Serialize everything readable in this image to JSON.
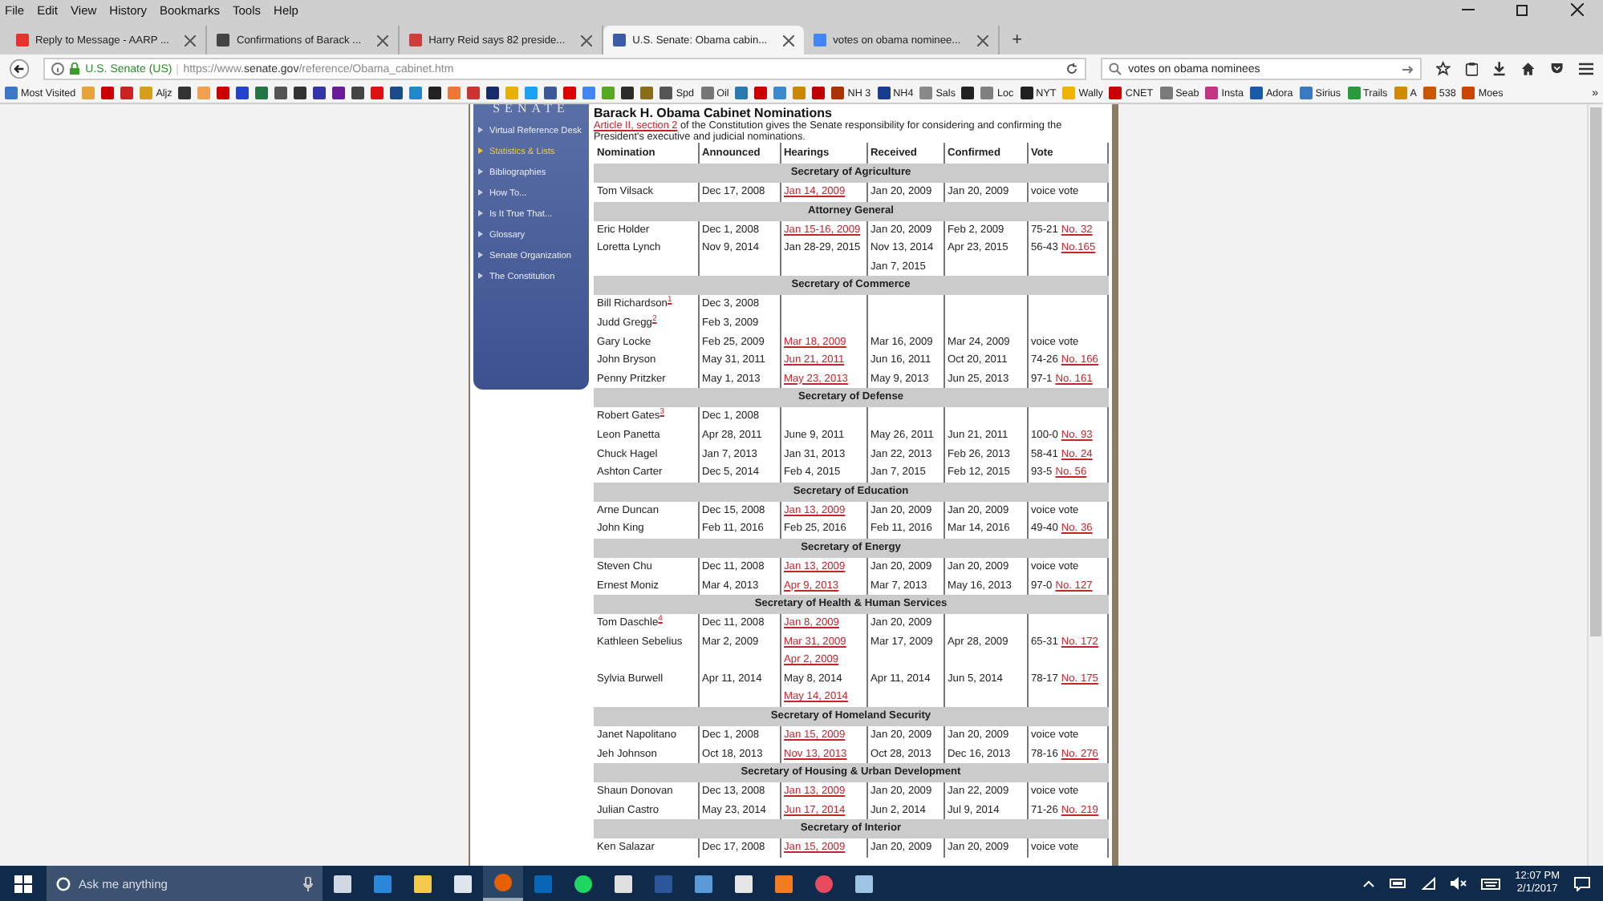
{
  "menu_bar": [
    "File",
    "Edit",
    "View",
    "History",
    "Bookmarks",
    "Tools",
    "Help"
  ],
  "tabs": [
    {
      "title": "Reply to Message - AARP ...",
      "selected": false,
      "color": "#e8322d"
    },
    {
      "title": "Confirmations of Barack ...",
      "selected": false,
      "color": "#444444"
    },
    {
      "title": "Harry Reid says 82 preside...",
      "selected": false,
      "color": "#d03c3c"
    },
    {
      "title": "U.S. Senate: Obama cabin...",
      "selected": true,
      "color": "#3b5ba8"
    },
    {
      "title": "votes on obama nominee...",
      "selected": false,
      "color": "#4285f4"
    }
  ],
  "new_tab": "+",
  "address": {
    "site": "U.S. Senate (US)",
    "url_prefix": "https://www.",
    "domain": "senate.gov",
    "url_path": "/reference/Obama_cabinet.htm"
  },
  "search_field": {
    "value": "votes on obama nominees"
  },
  "bookmarks": [
    {
      "label": "Most Visited",
      "color": "#3c78c8"
    },
    {
      "color": "#e8a33c"
    },
    {
      "color": "#cc0000"
    },
    {
      "color": "#cc2222"
    },
    {
      "label": "Aljz",
      "color": "#d4a017"
    },
    {
      "color": "#333333"
    },
    {
      "color": "#f0a050"
    },
    {
      "color": "#cc0000"
    },
    {
      "color": "#2244cc"
    },
    {
      "color": "#227744"
    },
    {
      "color": "#555555"
    },
    {
      "color": "#333333"
    },
    {
      "color": "#3333aa"
    },
    {
      "color": "#6a1b9a"
    },
    {
      "color": "#444444"
    },
    {
      "color": "#dd1111"
    },
    {
      "color": "#1a4c8c"
    },
    {
      "color": "#2288cc"
    },
    {
      "color": "#222222"
    },
    {
      "color": "#ee7733"
    },
    {
      "color": "#cc3333"
    },
    {
      "color": "#1a2a6c"
    },
    {
      "color": "#e8b000"
    },
    {
      "color": "#1da1f2"
    },
    {
      "color": "#3b5998"
    },
    {
      "color": "#dd0000"
    },
    {
      "color": "#4285f4"
    },
    {
      "color": "#55aa22"
    },
    {
      "color": "#2b2b2b"
    },
    {
      "color": "#8a6d1a"
    },
    {
      "label": "Spd",
      "color": "#555555"
    },
    {
      "label": "Oil",
      "color": "#777777"
    },
    {
      "color": "#2a7ab0"
    },
    {
      "color": "#cc0000"
    },
    {
      "color": "#3a8ad0"
    },
    {
      "color": "#cc8800"
    },
    {
      "color": "#c00000"
    },
    {
      "label": "NH 3",
      "color": "#aa3300"
    },
    {
      "label": "NH4",
      "color": "#1a3c8c"
    },
    {
      "label": "Sals",
      "color": "#888888"
    },
    {
      "color": "#222222"
    },
    {
      "label": "Loc",
      "color": "#808080"
    },
    {
      "label": "NYT",
      "color": "#202020"
    },
    {
      "label": "Wally",
      "color": "#f0b400"
    },
    {
      "label": "CNET",
      "color": "#cc0000"
    },
    {
      "label": "Seab",
      "color": "#7a7a7a"
    },
    {
      "label": "Insta",
      "color": "#c13584"
    },
    {
      "label": "Adora",
      "color": "#1a5aa8"
    },
    {
      "label": "Sirius",
      "color": "#3a7ac0"
    },
    {
      "label": "Trails",
      "color": "#2a9a3a"
    },
    {
      "label": "A",
      "color": "#d08a00"
    },
    {
      "label": "538",
      "color": "#cc5500"
    },
    {
      "label": "Moes",
      "color": "#cc4400"
    }
  ],
  "bookmarks_overflow": "»",
  "sidebar": {
    "logo": "SENATE",
    "items": [
      {
        "label": "Virtual Reference Desk",
        "selected": false
      },
      {
        "label": "Statistics & Lists",
        "selected": true
      },
      {
        "label": "Bibliographies",
        "selected": false
      },
      {
        "label": "How To...",
        "selected": false
      },
      {
        "label": "Is It True That...",
        "selected": false
      },
      {
        "label": "Glossary",
        "selected": false
      },
      {
        "label": "Senate Organization",
        "selected": false
      },
      {
        "label": "The Constitution",
        "selected": false
      }
    ]
  },
  "page_title": "Barack H. Obama Cabinet Nominations",
  "intro": {
    "link": "Article II, section 2",
    "text": " of the Constitution gives the Senate responsibility for considering and confirming the President's executive and judicial nominations."
  },
  "table": {
    "columns": [
      "Nomination",
      "Announced",
      "Hearings",
      "Received",
      "Confirmed",
      "Vote"
    ],
    "sections": [
      {
        "title": "Secretary of Agriculture",
        "rows": [
          {
            "name": "Tom Vilsack",
            "announced": "Dec 17, 2008",
            "hearings": [
              {
                "text": "Jan 14, 2009",
                "link": true
              }
            ],
            "received": [
              "Jan 20, 2009"
            ],
            "confirmed": "Jan 20, 2009",
            "vote": {
              "tally": "voice vote"
            }
          }
        ]
      },
      {
        "title": "Attorney General",
        "rows": [
          {
            "name": "Eric Holder",
            "announced": "Dec 1, 2008",
            "hearings": [
              {
                "text": "Jan 15-16, 2009",
                "link": true
              }
            ],
            "received": [
              "Jan 20, 2009"
            ],
            "confirmed": "Feb 2, 2009",
            "vote": {
              "tally": "75-21",
              "roll_call": "No. 32"
            }
          },
          {
            "name": "Loretta Lynch",
            "announced": "Nov 9, 2014",
            "hearings": [
              {
                "text": "Jan 28-29, 2015",
                "link": false
              }
            ],
            "received": [
              "Nov 13, 2014",
              "Jan 7, 2015"
            ],
            "confirmed": "Apr 23, 2015",
            "vote": {
              "tally": "56-43",
              "roll_call": "No.165"
            }
          }
        ]
      },
      {
        "title": "Secretary of Commerce",
        "rows": [
          {
            "name": "Bill Richardson",
            "footnote": "1",
            "announced": "Dec 3, 2008"
          },
          {
            "name": "Judd Gregg",
            "footnote": "2",
            "announced": "Feb 3, 2009"
          },
          {
            "name": "Gary Locke",
            "announced": "Feb 25, 2009",
            "hearings": [
              {
                "text": "Mar 18, 2009",
                "link": true
              }
            ],
            "received": [
              "Mar 16, 2009"
            ],
            "confirmed": "Mar 24, 2009",
            "vote": {
              "tally": "voice vote"
            }
          },
          {
            "name": "John Bryson",
            "announced": "May 31, 2011",
            "hearings": [
              {
                "text": "Jun 21, 2011",
                "link": true
              }
            ],
            "received": [
              "Jun 16, 2011"
            ],
            "confirmed": "Oct 20, 2011",
            "vote": {
              "tally": "74-26",
              "roll_call": "No. 166"
            }
          },
          {
            "name": "Penny Pritzker",
            "announced": "May 1, 2013",
            "hearings": [
              {
                "text": "May 23, 2013",
                "link": true
              }
            ],
            "received": [
              "May 9, 2013"
            ],
            "confirmed": "Jun 25, 2013",
            "vote": {
              "tally": "97-1",
              "roll_call": "No. 161"
            }
          }
        ]
      },
      {
        "title": "Secretary of Defense",
        "rows": [
          {
            "name": "Robert Gates",
            "footnote": "3",
            "announced": "Dec 1, 2008"
          },
          {
            "name": "Leon Panetta",
            "announced": "Apr 28, 2011",
            "hearings": [
              {
                "text": "June 9, 2011",
                "link": false
              }
            ],
            "received": [
              "May 26, 2011"
            ],
            "confirmed": "Jun 21, 2011",
            "vote": {
              "tally": "100-0",
              "roll_call": "No. 93"
            }
          },
          {
            "name": "Chuck Hagel",
            "announced": "Jan 7, 2013",
            "hearings": [
              {
                "text": "Jan 31, 2013",
                "link": false
              }
            ],
            "received": [
              "Jan 22, 2013"
            ],
            "confirmed": "Feb 26, 2013",
            "vote": {
              "tally": "58-41",
              "roll_call": "No. 24"
            }
          },
          {
            "name": "Ashton Carter",
            "announced": "Dec 5, 2014",
            "hearings": [
              {
                "text": "Feb 4, 2015",
                "link": false
              }
            ],
            "received": [
              "Jan 7, 2015"
            ],
            "confirmed": "Feb 12, 2015",
            "vote": {
              "tally": "93-5",
              "roll_call": "No. 56"
            }
          }
        ]
      },
      {
        "title": "Secretary of Education",
        "rows": [
          {
            "name": "Arne Duncan",
            "announced": "Dec 15, 2008",
            "hearings": [
              {
                "text": "Jan 13, 2009",
                "link": true
              }
            ],
            "received": [
              "Jan 20, 2009"
            ],
            "confirmed": "Jan 20, 2009",
            "vote": {
              "tally": "voice vote"
            }
          },
          {
            "name": "John King",
            "announced": "Feb 11, 2016",
            "hearings": [
              {
                "text": "Feb 25, 2016",
                "link": false
              }
            ],
            "received": [
              "Feb 11, 2016"
            ],
            "confirmed": "Mar 14, 2016",
            "vote": {
              "tally": "49-40",
              "roll_call": "No. 36"
            }
          }
        ]
      },
      {
        "title": "Secretary of Energy",
        "rows": [
          {
            "name": "Steven Chu",
            "announced": "Dec 11, 2008",
            "hearings": [
              {
                "text": "Jan 13, 2009",
                "link": true
              }
            ],
            "received": [
              "Jan 20, 2009"
            ],
            "confirmed": "Jan 20, 2009",
            "vote": {
              "tally": "voice vote"
            }
          },
          {
            "name": "Ernest Moniz",
            "announced": "Mar 4, 2013",
            "hearings": [
              {
                "text": "Apr 9, 2013",
                "link": true
              }
            ],
            "received": [
              "Mar 7, 2013"
            ],
            "confirmed": "May 16, 2013",
            "vote": {
              "tally": "97-0",
              "roll_call": "No. 127"
            }
          }
        ]
      },
      {
        "title": "Secretary of Health & Human Services",
        "rows": [
          {
            "name": "Tom Daschle",
            "footnote": "4",
            "announced": "Dec 11, 2008",
            "hearings": [
              {
                "text": "Jan 8, 2009",
                "link": true
              }
            ],
            "received": [
              "Jan 20, 2009"
            ]
          },
          {
            "name": "Kathleen Sebelius",
            "announced": "Mar 2, 2009",
            "hearings": [
              {
                "text": "Mar 31, 2009",
                "link": true
              },
              {
                "text": "Apr 2, 2009",
                "link": true
              }
            ],
            "received": [
              "Mar 17, 2009"
            ],
            "confirmed": "Apr 28, 2009",
            "vote": {
              "tally": "65-31",
              "roll_call": "No. 172"
            }
          },
          {
            "name": "Sylvia Burwell",
            "announced": "Apr 11, 2014",
            "hearings": [
              {
                "text": "May 8, 2014",
                "link": false
              },
              {
                "text": "May 14, 2014",
                "link": true
              }
            ],
            "received": [
              "Apr 11, 2014"
            ],
            "confirmed": "Jun 5, 2014",
            "vote": {
              "tally": "78-17",
              "roll_call": "No. 175"
            }
          }
        ]
      },
      {
        "title": "Secretary of Homeland Security",
        "rows": [
          {
            "name": "Janet Napolitano",
            "announced": "Dec 1, 2008",
            "hearings": [
              {
                "text": "Jan 15, 2009",
                "link": true
              }
            ],
            "received": [
              "Jan 20, 2009"
            ],
            "confirmed": "Jan 20, 2009",
            "vote": {
              "tally": "voice vote"
            }
          },
          {
            "name": "Jeh Johnson",
            "announced": "Oct 18, 2013",
            "hearings": [
              {
                "text": "Nov 13, 2013",
                "link": true
              }
            ],
            "received": [
              "Oct 28, 2013"
            ],
            "confirmed": "Dec 16, 2013",
            "vote": {
              "tally": "78-16",
              "roll_call": "No. 276"
            }
          }
        ]
      },
      {
        "title": "Secretary of Housing & Urban Development",
        "rows": [
          {
            "name": "Shaun Donovan",
            "announced": "Dec 13, 2008",
            "hearings": [
              {
                "text": "Jan 13, 2009",
                "link": true
              }
            ],
            "received": [
              "Jan 20, 2009"
            ],
            "confirmed": "Jan 22, 2009",
            "vote": {
              "tally": "voice vote"
            }
          },
          {
            "name": "Julian Castro",
            "announced": "May 23, 2014",
            "hearings": [
              {
                "text": "Jun 17, 2014",
                "link": true
              }
            ],
            "received": [
              "Jun 2, 2014"
            ],
            "confirmed": "Jul 9, 2014",
            "vote": {
              "tally": "71-26",
              "roll_call": "No. 219"
            }
          }
        ]
      },
      {
        "title": "Secretary of Interior",
        "rows": [
          {
            "name": "Ken Salazar",
            "announced": "Dec 17, 2008",
            "hearings": [
              {
                "text": "Jan 15, 2009",
                "link": true
              }
            ],
            "received": [
              "Jan 20, 2009"
            ],
            "confirmed": "Jan 20, 2009",
            "vote": {
              "tally": "voice vote"
            }
          }
        ]
      }
    ]
  },
  "taskbar": {
    "search_placeholder": "Ask me anything",
    "apps": [
      {
        "kind": "taskview",
        "active": false
      },
      {
        "kind": "edge",
        "active": false
      },
      {
        "kind": "folder",
        "active": false
      },
      {
        "kind": "store",
        "active": false
      },
      {
        "kind": "firefox",
        "active": true
      },
      {
        "kind": "outlook",
        "active": false
      },
      {
        "kind": "spotify",
        "active": false
      },
      {
        "kind": "calculator",
        "active": false
      },
      {
        "kind": "word",
        "active": false
      },
      {
        "kind": "photos",
        "active": false
      },
      {
        "kind": "calendar",
        "active": false
      },
      {
        "kind": "media",
        "active": false
      },
      {
        "kind": "pinwheel",
        "active": false
      },
      {
        "kind": "paint",
        "active": false
      }
    ],
    "time": "12:07 PM",
    "date": "2/1/2017"
  }
}
